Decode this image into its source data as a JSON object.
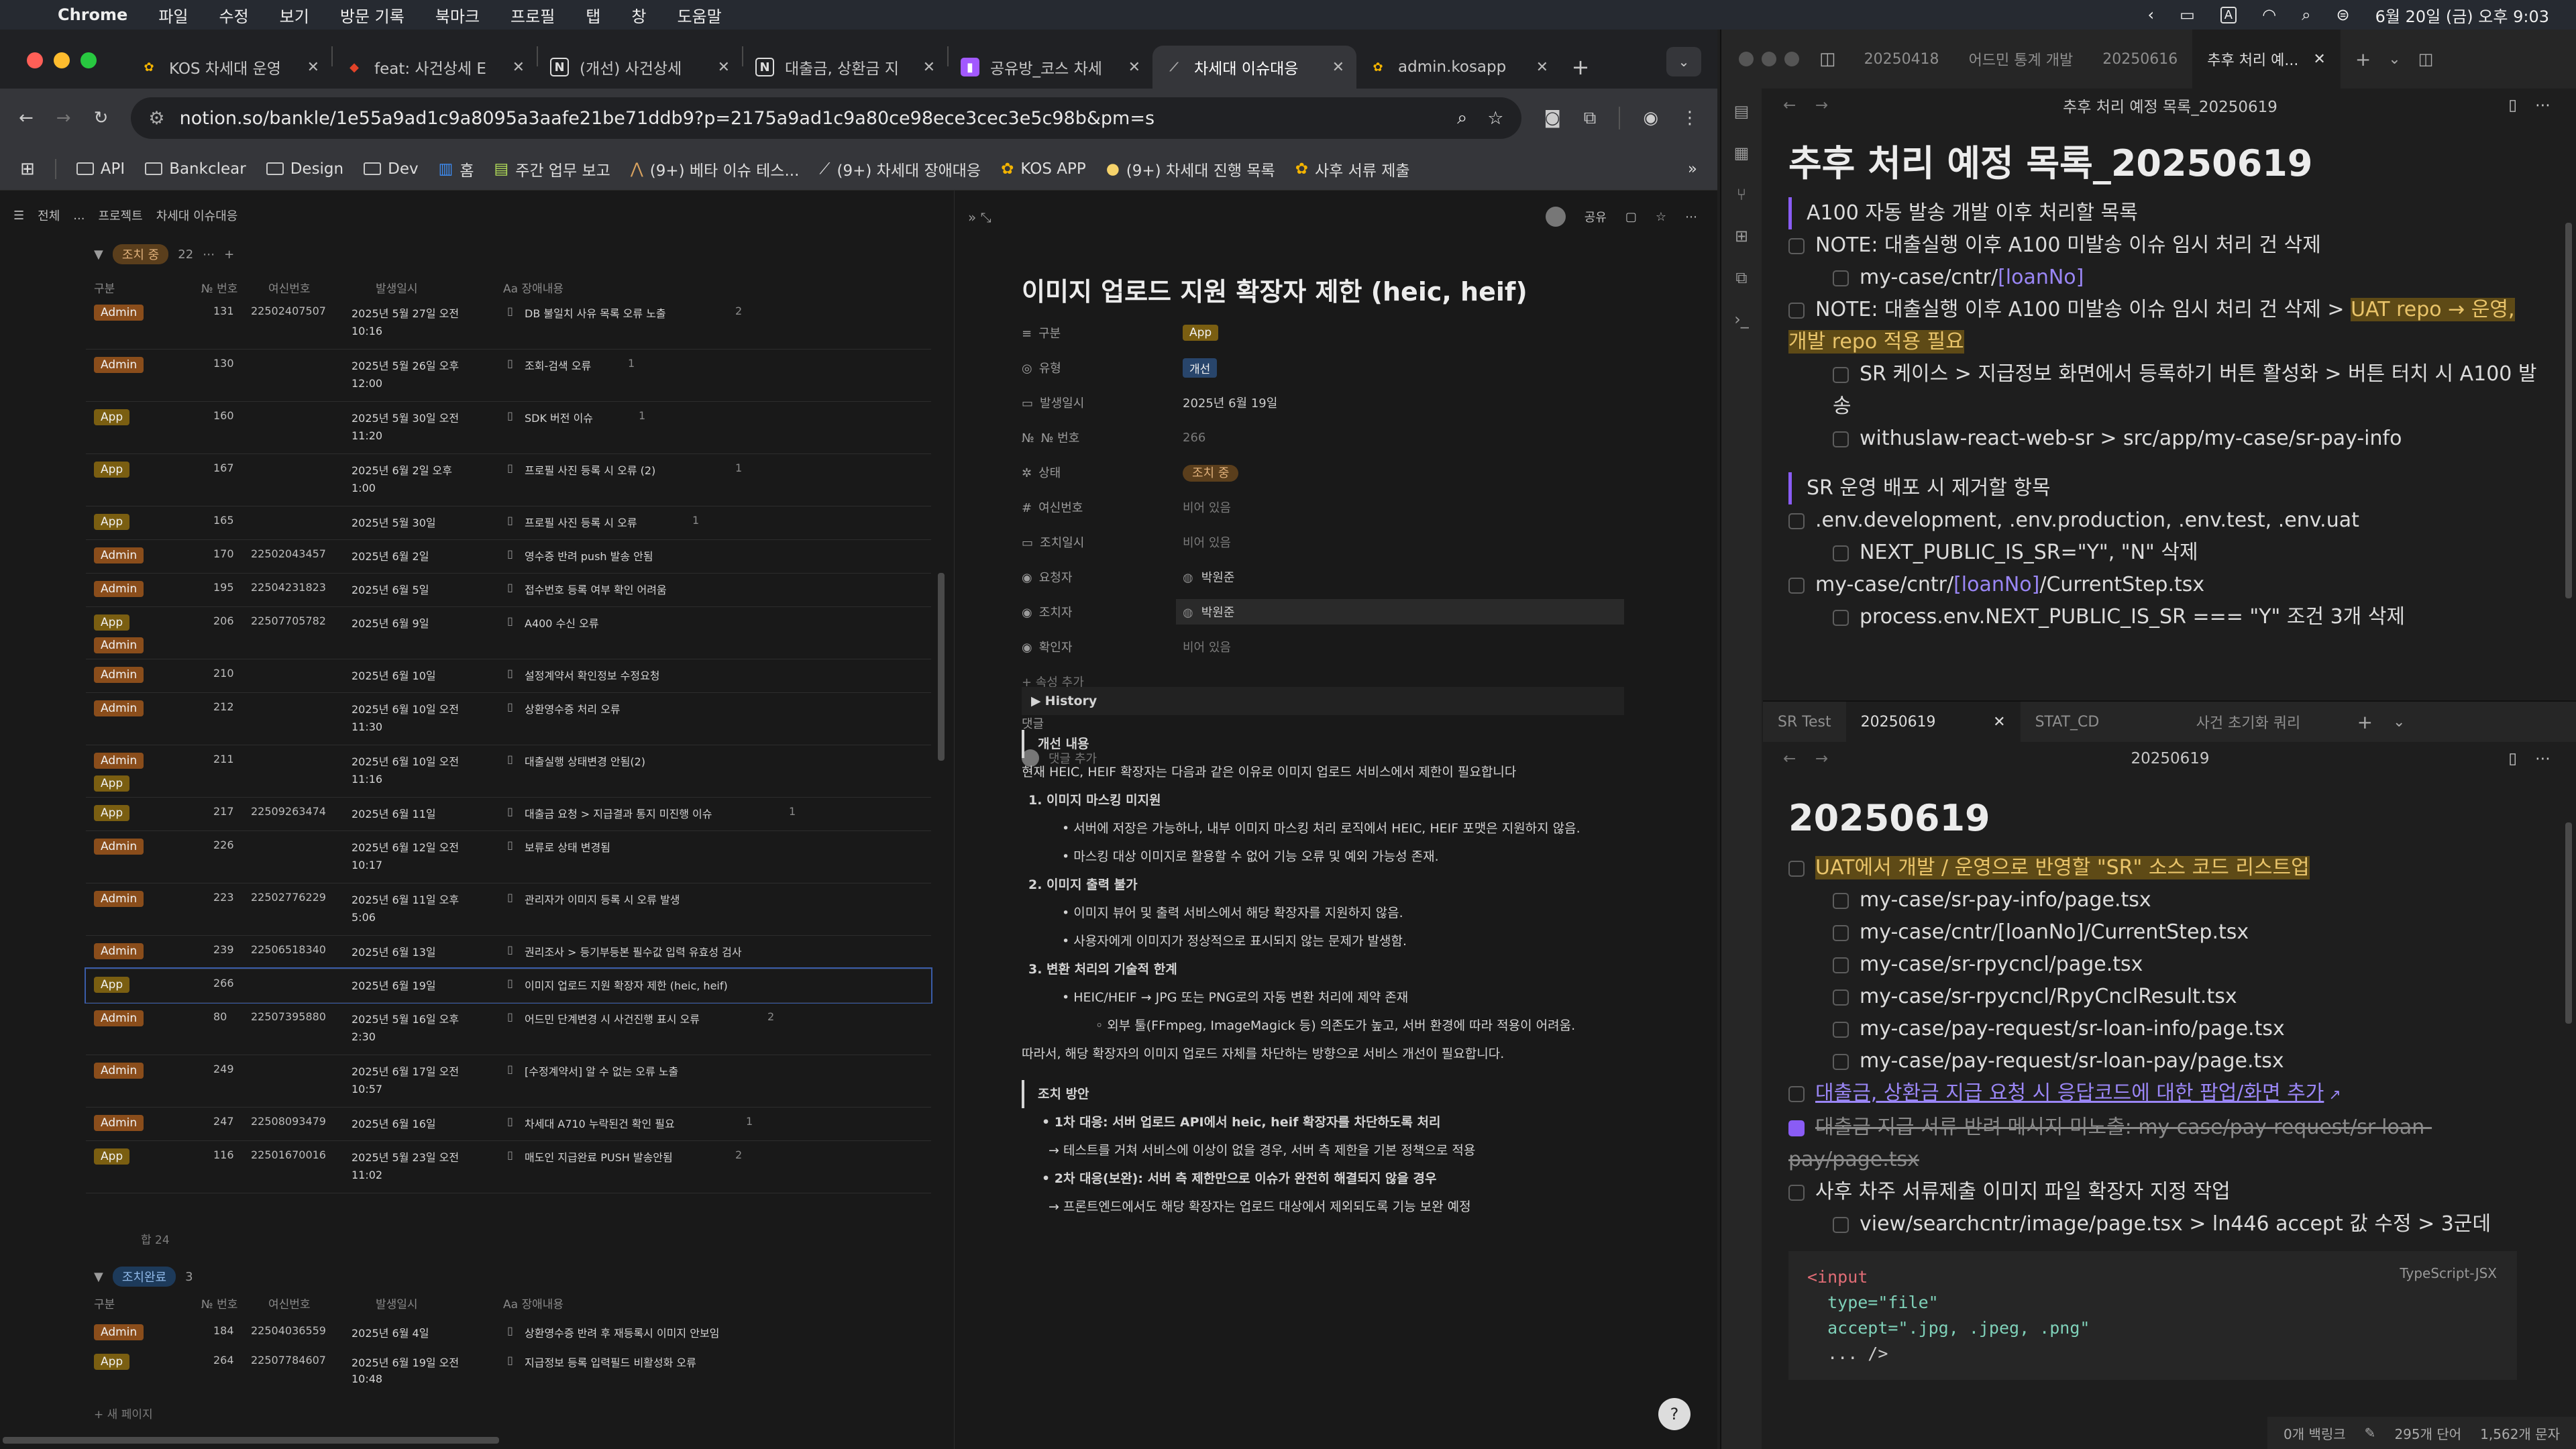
{
  "menubar": {
    "app": "Chrome",
    "items": [
      "파일",
      "수정",
      "보기",
      "방문 기록",
      "북마크",
      "프로필",
      "탭",
      "창",
      "도움말"
    ],
    "datetime": "6월 20일 (금) 오후 9:03"
  },
  "tabs": [
    {
      "title": "KOS 차세대 운영",
      "color": "#f4b400",
      "glyph": "✿"
    },
    {
      "title": "feat: 사건상세 E",
      "color": "#e24329",
      "glyph": "🦊"
    },
    {
      "title": "(개선) 사건상세",
      "color": "#ffffff",
      "glyph": "N"
    },
    {
      "title": "대출금, 상환금 지",
      "color": "#ffffff",
      "glyph": "N"
    },
    {
      "title": "공유방_코스 차세",
      "color": "#9c27b0",
      "glyph": "▮"
    },
    {
      "title": "차세대 이슈대응",
      "color": "#444444",
      "glyph": "⟋"
    },
    {
      "title": "admin.kosapp",
      "color": "#f4b400",
      "glyph": "✿"
    }
  ],
  "url": "notion.so/bankle/1e55a9ad1c9a8095a3aafe21be71ddb9?p=2175a9ad1c9a80ce98ece3cec3e5c98b&pm=s",
  "bookmarks": [
    "API",
    "Bankclear",
    "Design",
    "Dev",
    "홈",
    "주간 업무 보고",
    "(9+) 베타 이슈 테스...",
    "(9+) 차세대 장애대응",
    "KOS APP",
    "(9+) 차세대 진행 목록",
    "사후 서류 제출"
  ],
  "notion": {
    "breadcrumb": [
      "전체",
      "...",
      "프로젝트",
      "차세대 이슈대응"
    ],
    "share": "공유",
    "group1": {
      "label": "조치 중",
      "count": "22"
    },
    "columns": [
      "구분",
      "№ 번호",
      "여신번호",
      "발생일시",
      "Aa 장애내용"
    ],
    "rows": [
      {
        "tag": "Admin",
        "no": "131",
        "loan": "22502407507",
        "date": "2025년 5월 27일 오전",
        "date2": "10:16",
        "title": "DB 불일치 사유 목록 오류 노출",
        "cm": "2"
      },
      {
        "tag": "Admin",
        "no": "130",
        "loan": "",
        "date": "2025년 5월 26일 오후",
        "date2": "12:00",
        "title": "조회-검색 오류",
        "cm": "1"
      },
      {
        "tag": "App",
        "no": "160",
        "loan": "",
        "date": "2025년 5월 30일 오전",
        "date2": "11:20",
        "title": "SDK 버전 이슈",
        "cm": "1"
      },
      {
        "tag": "App",
        "no": "167",
        "loan": "",
        "date": "2025년 6월 2일 오후",
        "date2": "1:00",
        "title": "프로필 사진 등록 시 오류 (2)",
        "cm": "1"
      },
      {
        "tag": "App",
        "no": "165",
        "loan": "",
        "date": "2025년 5월 30일",
        "date2": "",
        "title": "프로필 사진 등록 시 오류",
        "cm": "1"
      },
      {
        "tag": "Admin",
        "no": "170",
        "loan": "22502043457",
        "date": "2025년 6월 2일",
        "date2": "",
        "title": "영수증 반려 push 발송 안됨",
        "cm": ""
      },
      {
        "tag": "Admin",
        "no": "195",
        "loan": "22504231823",
        "date": "2025년 6월 5일",
        "date2": "",
        "title": "접수번호 등록 여부 확인 어려움",
        "cm": ""
      },
      {
        "tag": "App",
        "tag2": "Admin",
        "no": "206",
        "loan": "22507705782",
        "date": "2025년 6월 9일",
        "date2": "",
        "title": "A400 수신 오류",
        "cm": ""
      },
      {
        "tag": "Admin",
        "no": "210",
        "loan": "",
        "date": "2025년 6월 10일",
        "date2": "",
        "title": "설정계약서 확인정보 수정요청",
        "cm": ""
      },
      {
        "tag": "Admin",
        "no": "212",
        "loan": "",
        "date": "2025년 6월 10일 오전",
        "date2": "11:30",
        "title": "상환영수증 처리 오류",
        "cm": ""
      },
      {
        "tag": "Admin",
        "tag2": "App",
        "no": "211",
        "loan": "",
        "date": "2025년 6월 10일 오전",
        "date2": "11:16",
        "title": "대출실행 상태변경 안됨(2)",
        "cm": ""
      },
      {
        "tag": "App",
        "no": "217",
        "loan": "22509263474",
        "date": "2025년 6월 11일",
        "date2": "",
        "title": "대출금 요청 > 지급결과 통지 미진행 이슈",
        "cm": "1"
      },
      {
        "tag": "Admin",
        "no": "226",
        "loan": "",
        "date": "2025년 6월 12일 오전",
        "date2": "10:17",
        "title": "보류로 상태 변경됨",
        "cm": ""
      },
      {
        "tag": "Admin",
        "no": "223",
        "loan": "22502776229",
        "date": "2025년 6월 11일 오후",
        "date2": "5:06",
        "title": "관리자가 이미지 등록 시 오류 발생",
        "cm": ""
      },
      {
        "tag": "Admin",
        "no": "239",
        "loan": "22506518340",
        "date": "2025년 6월 13일",
        "date2": "",
        "title": "권리조사 > 등기부등본 필수값 입력 유효성 검사",
        "cm": ""
      },
      {
        "tag": "App",
        "no": "266",
        "loan": "",
        "date": "2025년 6월 19일",
        "date2": "",
        "title": "이미지 업로드 지원 확장자 제한 (heic, heif)",
        "cm": ""
      },
      {
        "tag": "Admin",
        "no": "80",
        "loan": "22507395880",
        "date": "2025년 5월 16일 오후",
        "date2": "2:30",
        "title": "어드민 단계변경 시 사건진행 표시 오류",
        "cm": "2"
      },
      {
        "tag": "Admin",
        "no": "249",
        "loan": "",
        "date": "2025년 6월 17일 오전",
        "date2": "10:57",
        "title": "[수정계약서] 알 수 없는 오류 노출",
        "cm": ""
      },
      {
        "tag": "Admin",
        "no": "247",
        "loan": "22508093479",
        "date": "2025년 6월 16일",
        "date2": "",
        "title": "차세대 A710 누락된건 확인 필요",
        "cm": "1"
      },
      {
        "tag": "App",
        "no": "116",
        "loan": "22501670016",
        "date": "2025년 5월 23일 오전",
        "date2": "11:02",
        "title": "매도인 지급완료 PUSH 발송안됨",
        "cm": "2"
      }
    ],
    "new_page": "+ 새 페이지",
    "sum": "합 24",
    "group2": {
      "label": "조치완료",
      "count": "3"
    },
    "rows2": [
      {
        "tag": "Admin",
        "no": "184",
        "loan": "22504036559",
        "date": "2025년 6월 4일",
        "date2": "",
        "title": "상환영수증 반려 후 재등록시 이미지 안보임"
      },
      {
        "tag": "App",
        "no": "264",
        "loan": "22507784607",
        "date": "2025년 6월 19일 오전",
        "date2": "10:48",
        "title": "지급정보 등록 입력필드 비활성화 오류"
      }
    ],
    "detail": {
      "title": "이미지 업로드 지원 확장자 제한 (heic, heif)",
      "props": [
        {
          "k": "구분",
          "v": "App",
          "type": "tag"
        },
        {
          "k": "유형",
          "v": "개선",
          "type": "tagblue"
        },
        {
          "k": "발생일시",
          "v": "2025년 6월 19일",
          "type": "text"
        },
        {
          "k": "№ 번호",
          "v": "266",
          "type": "muted"
        },
        {
          "k": "상태",
          "v": "조치 중",
          "type": "status"
        },
        {
          "k": "여신번호",
          "v": "비어 있음",
          "type": "muted"
        },
        {
          "k": "조치일시",
          "v": "비어 있음",
          "type": "muted"
        },
        {
          "k": "요청자",
          "v": "박원준",
          "type": "person"
        },
        {
          "k": "조치자",
          "v": "박원준",
          "type": "person"
        },
        {
          "k": "확인자",
          "v": "비어 있음",
          "type": "muted"
        }
      ],
      "add_prop": "+ 속성 추가",
      "comment_label": "댓글",
      "comment_add": "댓글 추가",
      "history": "History",
      "h1": "개선 내용",
      "intro": "현재 HEIC, HEIF 확장자는 다음과 같은 이유로 이미지 업로드 서비스에서 제한이 필요합니다",
      "sections": [
        {
          "t": "1. 이미지 마스킹 미지원",
          "items": [
            "서버에 저장은 가능하나, 내부 이미지 마스킹 처리 로직에서 HEIC, HEIF 포맷은 지원하지 않음.",
            "마스킹 대상 이미지로 활용할 수 없어 기능 오류 및 예외 가능성 존재."
          ]
        },
        {
          "t": "2. 이미지 출력 불가",
          "items": [
            "이미지 뷰어 및 출력 서비스에서 해당 확장자를 지원하지 않음.",
            "사용자에게 이미지가 정상적으로 표시되지 않는 문제가 발생함."
          ]
        },
        {
          "t": "3. 변환 처리의 기술적 한계",
          "items": [
            "HEIC/HEIF → JPG 또는 PNG로의 자동 변환 처리에 제약 존재"
          ],
          "sub": "외부 툴(FFmpeg, ImageMagick 등) 의존도가 높고, 서버 환경에 따라 적용이 어려움."
        }
      ],
      "conclusion": "따라서, 해당 확장자의 이미지 업로드 자체를 차단하는 방향으로 서비스 개선이 필요합니다.",
      "h2": "조치 방안",
      "plan": [
        {
          "t": "1차 대응: 서버 업로드 API에서 heic, heif 확장자를 차단하도록 처리",
          "sub": "→ 테스트를 거쳐 서비스에 이상이 없을 경우, 서버 측 제한을 기본 정책으로 적용"
        },
        {
          "t": "2차 대응(보완): 서버 측 제한만으로 이슈가 완전히 해결되지 않을 경우",
          "sub": "→ 프론트엔드에서도 해당 확장자는 업로드 대상에서 제외되도록 기능 보완 예정"
        }
      ]
    }
  },
  "obsidian": {
    "top_tabs": [
      "20250418",
      "어드민 통계 개발",
      "20250616",
      "추후 처리 예..."
    ],
    "top_title": "추후 처리 예정 목록_20250619",
    "doc1": {
      "h": "추후 처리 예정 목록_20250619",
      "q1": "A100 자동 발송 개발 이후 처리할 목록",
      "l1": "NOTE: 대출실행 이후 A100 미발송 이슈 임시 처리 건 삭제",
      "l1a": "my-case/cntr/",
      "l1b": "[loanNo]",
      "l2": "NOTE: 대출실행 이후 A100 미발송 이슈 임시 처리 건 삭제 > ",
      "l2h": "UAT repo → 운영, 개발 repo 적용 필요",
      "l2a": "SR 케이스 > 지급정보 화면에서 등록하기 버튼 활성화 > 버튼 터치 시 A100 발송",
      "l2b": "withuslaw-react-web-sr > src/app/my-case/sr-pay-info",
      "q2": "SR 운영 배포 시 제거할 항목",
      "l3": ".env.development, .env.production, .env.test, .env.uat",
      "l3a": "NEXT_PUBLIC_IS_SR=\"Y\", \"N\" 삭제",
      "l4a": "my-case/cntr/",
      "l4b": "[loanNo]",
      "l4c": "/CurrentStep.tsx",
      "l4d": "process.env.NEXT_PUBLIC_IS_SR === \"Y\" 조건 3개 삭제"
    },
    "bottom_tabs": [
      "SR Test",
      "20250619",
      "STAT_CD",
      "사건 초기화 쿼리"
    ],
    "bottom_title": "20250619",
    "doc2": {
      "h": "20250619",
      "l1": "UAT에서 개발 / 운영으로 반영할 \"SR\" 소스 코드 리스트업",
      "files": [
        "my-case/sr-pay-info/page.tsx",
        "my-case/cntr/[loanNo]/CurrentStep.tsx",
        "my-case/sr-rpycncl/page.tsx",
        "my-case/sr-rpycncl/RpyCnclResult.tsx",
        "my-case/pay-request/sr-loan-info/page.tsx",
        "my-case/pay-request/sr-loan-pay/page.tsx"
      ],
      "l2": "대출금, 상환금 지급 요청 시 응답코드에 대한 팝업/화면 추가",
      "l3": "대출금 지급 서류 반려 메시지 미노출: my-case/pay-request/sr-loan-pay/page.tsx",
      "l4": "사후 차주 서류제출 이미지 파일 확장자 지정 작업",
      "l4a": "view/searchcntr/image/page.tsx > ln446 accept 값 수정 > 3군데",
      "code_lang": "TypeScript-JSX",
      "code": [
        "<input",
        "  type=\"file\"",
        "  accept=\".jpg, .jpeg, .png\"",
        "  ... />"
      ]
    },
    "status": [
      "0개 백링크",
      "295개 단어",
      "1,562개 문자"
    ]
  }
}
